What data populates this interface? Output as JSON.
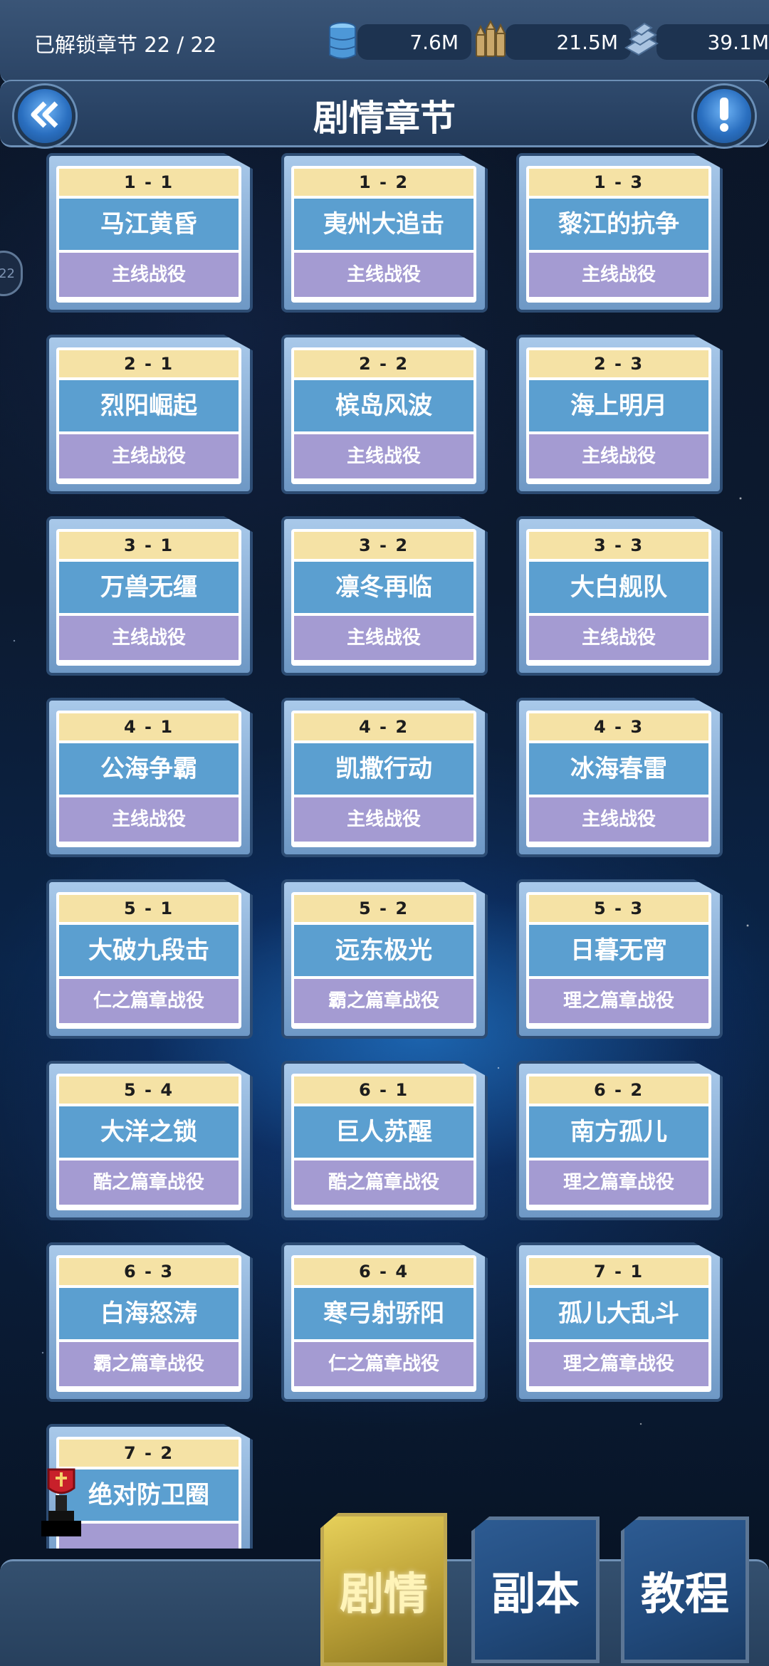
{
  "resources": {
    "unlock_label": "已解锁章节 22 / 22",
    "items": [
      {
        "icon": "oil-barrel-icon",
        "value": "7.6M"
      },
      {
        "icon": "ammo-shells-icon",
        "value": "21.5M"
      },
      {
        "icon": "steel-beam-icon",
        "value": "39.1M"
      }
    ]
  },
  "header": {
    "title": "剧情章节",
    "back_icon": "double-chevron-left-icon",
    "info_icon": "exclamation-icon"
  },
  "side_handle": {
    "label": "22"
  },
  "chapters": [
    {
      "num": "1 - 1",
      "title": "马江黄昏",
      "type": "主线战役"
    },
    {
      "num": "1 - 2",
      "title": "夷州大追击",
      "type": "主线战役"
    },
    {
      "num": "1 - 3",
      "title": "黎江的抗争",
      "type": "主线战役"
    },
    {
      "num": "2 - 1",
      "title": "烈阳崛起",
      "type": "主线战役"
    },
    {
      "num": "2 - 2",
      "title": "槟岛风波",
      "type": "主线战役"
    },
    {
      "num": "2 - 3",
      "title": "海上明月",
      "type": "主线战役"
    },
    {
      "num": "3 - 1",
      "title": "万兽无缰",
      "type": "主线战役"
    },
    {
      "num": "3 - 2",
      "title": "凛冬再临",
      "type": "主线战役"
    },
    {
      "num": "3 - 3",
      "title": "大白舰队",
      "type": "主线战役"
    },
    {
      "num": "4 - 1",
      "title": "公海争霸",
      "type": "主线战役"
    },
    {
      "num": "4 - 2",
      "title": "凯撒行动",
      "type": "主线战役"
    },
    {
      "num": "4 - 3",
      "title": "冰海春雷",
      "type": "主线战役"
    },
    {
      "num": "5 - 1",
      "title": "大破九段击",
      "type": "仁之篇章战役"
    },
    {
      "num": "5 - 2",
      "title": "远东极光",
      "type": "霸之篇章战役"
    },
    {
      "num": "5 - 3",
      "title": "日暮无宵",
      "type": "理之篇章战役"
    },
    {
      "num": "5 - 4",
      "title": "大洋之锁",
      "type": "酷之篇章战役"
    },
    {
      "num": "6 - 1",
      "title": "巨人苏醒",
      "type": "酷之篇章战役"
    },
    {
      "num": "6 - 2",
      "title": "南方孤儿",
      "type": "理之篇章战役"
    },
    {
      "num": "6 - 3",
      "title": "白海怒涛",
      "type": "霸之篇章战役"
    },
    {
      "num": "6 - 4",
      "title": "寒弓射骄阳",
      "type": "仁之篇章战役"
    },
    {
      "num": "7 - 1",
      "title": "孤儿大乱斗",
      "type": "理之篇章战役"
    },
    {
      "num": "7 - 2",
      "title": "绝对防卫圈",
      "type": ""
    }
  ],
  "tabs": {
    "story": "剧情",
    "dungeon": "副本",
    "tutorial": "教程"
  }
}
